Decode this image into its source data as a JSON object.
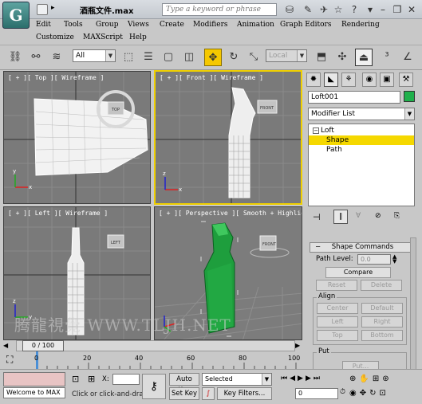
{
  "titlebar": {
    "logo_letter": "G",
    "title": "酒瓶文件.max",
    "search_placeholder": "Type a keyword or phrase"
  },
  "menu": [
    "Edit",
    "Tools",
    "Group",
    "Views",
    "Create",
    "Modifiers",
    "Animation",
    "Graph Editors",
    "Rendering",
    "Customize",
    "MAXScript",
    "Help"
  ],
  "toolbar": {
    "selection_filter": "All",
    "coord_system": "Local"
  },
  "viewports": {
    "top": "[ + ][ Top ][ Wireframe ]",
    "front": "[ + ][ Front ][ Wireframe ]",
    "left": "[ + ][ Left ][ Wireframe ]",
    "perspective": "[ + ][ Perspective ][ Smooth + Highlight ]",
    "viewcube_top": "TOP",
    "viewcube_front": "FRONT",
    "viewcube_left": "LEFT",
    "axis_x": "x",
    "axis_y": "y",
    "axis_z": "z"
  },
  "panel": {
    "object_name": "Loft001",
    "object_color": "#1fb04b",
    "modifier_list": "Modifier List",
    "stack": [
      {
        "label": "Loft",
        "selected": false
      },
      {
        "label": "Shape",
        "selected": true
      },
      {
        "label": "Path",
        "selected": false
      }
    ],
    "shape_commands": {
      "header": "Shape Commands",
      "path_level_label": "Path Level:",
      "path_level_value": "0.0",
      "compare": "Compare",
      "reset": "Reset",
      "delete": "Delete",
      "align_label": "Align",
      "center": "Center",
      "default": "Default",
      "left": "Left",
      "right": "Right",
      "top": "Top",
      "bottom": "Bottom",
      "put_label": "Put",
      "put_button": "Put..."
    }
  },
  "timeline": {
    "position": "0 / 100",
    "ticks": [
      "0",
      "20",
      "40",
      "60",
      "80",
      "100"
    ]
  },
  "statusbar": {
    "maxscript_listener": "Welcome to MAX",
    "prompt": "Click or click-and-dra",
    "x_label": "X:",
    "auto_key": "Auto Key",
    "set_key": "Set Key",
    "key_mode": "Selected",
    "key_filters": "Key Filters...",
    "frame": "0"
  },
  "watermark": "腾龍視覺 WWW.TLJH.NET"
}
